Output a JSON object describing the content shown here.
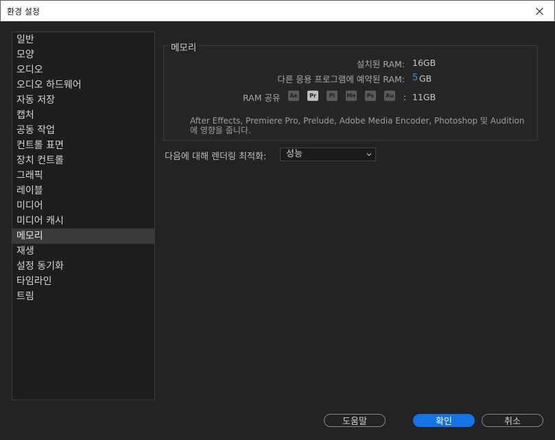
{
  "window": {
    "title": "환경 설정"
  },
  "sidebar": {
    "items": [
      {
        "label": "일반"
      },
      {
        "label": "모양"
      },
      {
        "label": "오디오"
      },
      {
        "label": "오디오 하드웨어"
      },
      {
        "label": "자동 저장"
      },
      {
        "label": "캡처"
      },
      {
        "label": "공동 작업"
      },
      {
        "label": "컨트롤 표면"
      },
      {
        "label": "장치 컨트롤"
      },
      {
        "label": "그래픽"
      },
      {
        "label": "레이블"
      },
      {
        "label": "미디어"
      },
      {
        "label": "미디어 캐시"
      },
      {
        "label": "메모리"
      },
      {
        "label": "재생"
      },
      {
        "label": "설정 동기화"
      },
      {
        "label": "타임라인"
      },
      {
        "label": "트림"
      }
    ],
    "active_index": 13
  },
  "memory": {
    "group_title": "메모리",
    "installed_label": "설치된 RAM:",
    "installed_value": "16GB",
    "reserved_label": "다른 응용 프로그램에 예약된 RAM:",
    "reserved_value": "5",
    "reserved_unit": "GB",
    "shared_label": "RAM 공유",
    "apps": [
      {
        "abbr": "Ae",
        "active": false
      },
      {
        "abbr": "Pr",
        "active": true
      },
      {
        "abbr": "Pl",
        "active": false
      },
      {
        "abbr": "Me",
        "active": false
      },
      {
        "abbr": "Ps",
        "active": false
      },
      {
        "abbr": "Au",
        "active": false
      }
    ],
    "shared_separator": ":",
    "shared_value": "11GB",
    "note_line1": "After Effects, Premiere Pro, Prelude, Adobe Media Encoder, Photoshop 및 Audition",
    "note_line2": "에 영향을 줍니다."
  },
  "render": {
    "label": "다음에 대해 렌더링 최적화:",
    "selected": "성능"
  },
  "buttons": {
    "help": "도움말",
    "ok": "확인",
    "cancel": "취소"
  },
  "colors": {
    "accent": "#1473e6",
    "value_blue": "#3a8ee6",
    "background": "#232323"
  },
  "icons": {
    "close": "close-icon",
    "dropdown": "chevron-down-icon"
  }
}
